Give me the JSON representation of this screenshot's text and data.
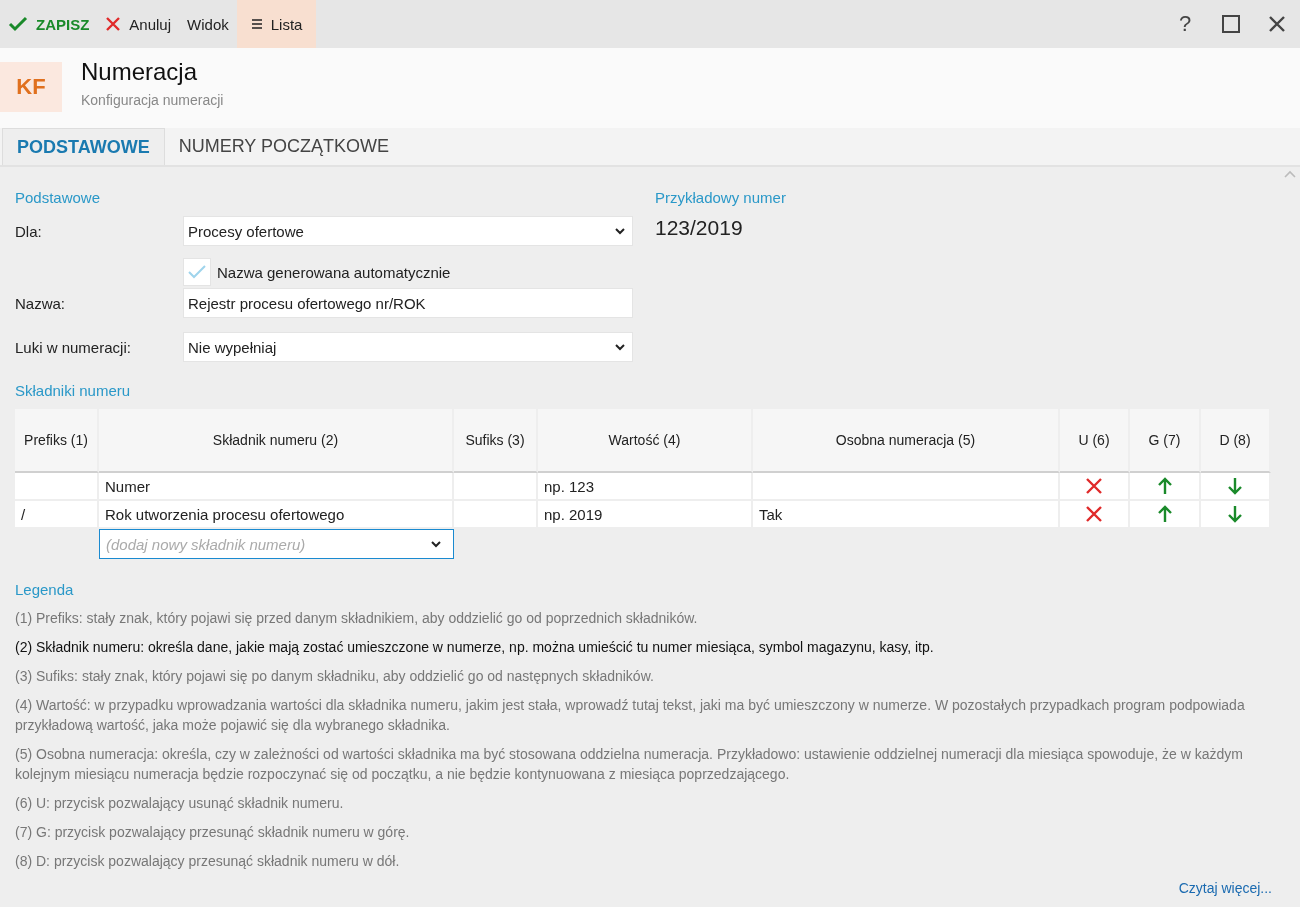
{
  "toolbar": {
    "items": [
      {
        "kind": "save",
        "label": "ZAPISZ",
        "selected": false
      },
      {
        "kind": "cancel",
        "label": "Anuluj",
        "selected": false
      },
      {
        "kind": "plain",
        "label": "Widok",
        "selected": false
      },
      {
        "kind": "list",
        "label": "Lista",
        "selected": true
      }
    ],
    "help": "?"
  },
  "header": {
    "badge": "KF",
    "title": "Numeracja",
    "subtitle": "Konfiguracja numeracji"
  },
  "tabs": [
    {
      "label": "PODSTAWOWE",
      "selected": true
    },
    {
      "label": "NUMERY POCZĄTKOWE",
      "selected": false
    }
  ],
  "basic": {
    "heading": "Podstawowe",
    "dla": {
      "label": "Dla:",
      "value": "Procesy ofertowe"
    },
    "auto_name": {
      "label": "Nazwa generowana automatycznie",
      "checked": true
    },
    "nazwa": {
      "label": "Nazwa:",
      "value": "Rejestr procesu ofertowego nr/ROK"
    },
    "luki": {
      "label": "Luki w numeracji:",
      "value": "Nie wypełniaj"
    }
  },
  "example": {
    "heading": "Przykładowy numer",
    "value": "123/2019"
  },
  "components": {
    "heading": "Składniki numeru",
    "columns": [
      "Prefiks (1)",
      "Składnik numeru (2)",
      "Sufiks (3)",
      "Wartość (4)",
      "Osobna numeracja (5)",
      "U (6)",
      "G (7)",
      "D (8)"
    ],
    "rows": [
      {
        "prefix": "",
        "component": "Numer",
        "suffix": "",
        "value": "np. 123",
        "separate": ""
      },
      {
        "prefix": "/",
        "component": "Rok utworzenia procesu ofertowego",
        "suffix": "",
        "value": "np. 2019",
        "separate": "Tak"
      }
    ],
    "add_placeholder": "(dodaj nowy składnik numeru)"
  },
  "legend": {
    "heading": "Legenda",
    "items": [
      {
        "text": "(1) Prefiks: stały znak, który pojawi się przed danym składnikiem, aby oddzielić go od poprzednich składników.",
        "highlighted": false
      },
      {
        "text": "(2) Składnik numeru: określa dane, jakie mają zostać umieszczone w numerze, np. można umieścić tu numer miesiąca, symbol magazynu, kasy, itp.",
        "highlighted": true
      },
      {
        "text": "(3) Sufiks: stały znak, który pojawi się po danym składniku, aby oddzielić go od następnych składników.",
        "highlighted": false
      },
      {
        "text": "(4) Wartość: w przypadku wprowadzania wartości dla składnika numeru, jakim jest stała,  wprowadź tutaj tekst, jaki ma być umieszczony  w numerze. W pozostałych przypadkach program podpowiada przykładową wartość, jaka może pojawić się dla wybranego składnika.",
        "highlighted": false
      },
      {
        "text": "(5) Osobna numeracja: określa, czy w zależności od wartości składnika ma być stosowana oddzielna numeracja. Przykładowo: ustawienie oddzielnej numeracji dla miesiąca spowoduje, że w każdym kolejnym miesiącu numeracja będzie rozpoczynać się od początku, a nie będzie kontynuowana z miesiąca poprzedzającego.",
        "highlighted": false
      },
      {
        "text": "(6) U: przycisk pozwalający usunąć składnik numeru.",
        "highlighted": false
      },
      {
        "text": "(7) G: przycisk pozwalający przesunąć składnik numeru w górę.",
        "highlighted": false
      },
      {
        "text": "(8) D: przycisk pozwalający przesunąć składnik numeru w dół.",
        "highlighted": false
      }
    ],
    "more_link": "Czytaj więcej..."
  }
}
